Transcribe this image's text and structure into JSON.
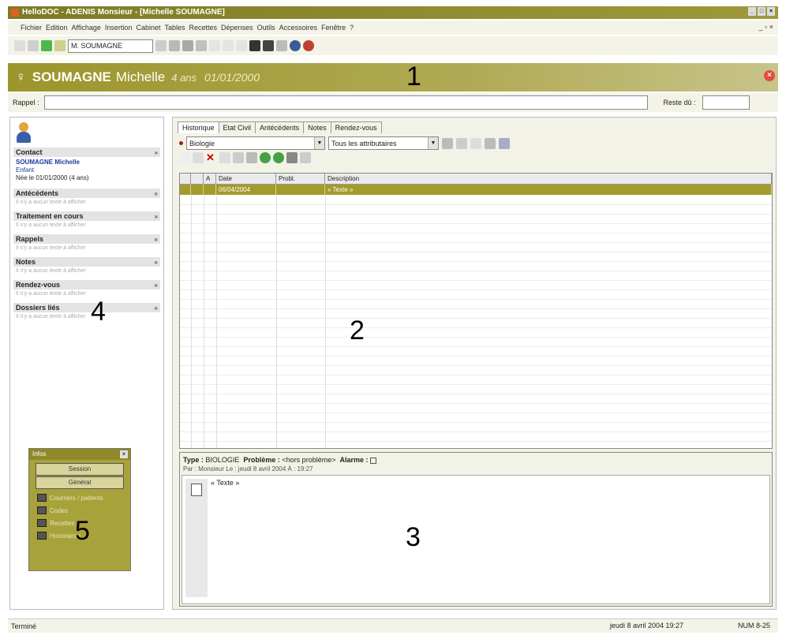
{
  "window": {
    "title": "HelloDOC - ADENIS Monsieur - [Michelle SOUMAGNE]"
  },
  "menu": [
    "Fichier",
    "Edition",
    "Affichage",
    "Insertion",
    "Cabinet",
    "Tables",
    "Recettes",
    "Dépenses",
    "Outils",
    "Accessoires",
    "Fenêtre",
    "?"
  ],
  "toolbar": {
    "patient_combo": "M. SOUMAGNE"
  },
  "header": {
    "last_name": "SOUMAGNE",
    "first_name": "Michelle",
    "age": "4 ans",
    "birth_date": "01/01/2000"
  },
  "rappel": {
    "label": "Rappel :",
    "value": "",
    "reste_label": "Reste dû :",
    "reste_value": ""
  },
  "left_panel": {
    "contact": {
      "title": "Contact",
      "name": "SOUMAGNE Michelle",
      "role": "Enfant",
      "born": "Née le 01/01/2000 (4 ans)"
    },
    "empty_text": "Il n'y a aucun texte à afficher",
    "sections": [
      "Antécédents",
      "Traitement en cours",
      "Rappels",
      "Notes",
      "Rendez-vous",
      "Dossiers liés"
    ]
  },
  "tabs": [
    "Historique",
    "Etat Civil",
    "Antécédents",
    "Notes",
    "Rendez-vous"
  ],
  "filters": {
    "type": "Biologie",
    "attributes": "Tous les attributaires"
  },
  "grid": {
    "columns": [
      "",
      "",
      "A",
      "Date",
      "Probl.",
      "Description"
    ],
    "rows": [
      {
        "c1": "",
        "c2": "",
        "date": "06/04/2004",
        "prob": "",
        "desc": "« Texte »"
      }
    ]
  },
  "detail": {
    "type_label": "Type :",
    "type_value": "BIOLOGIE",
    "problem_label": "Problème :",
    "problem_value": "<hors problème>",
    "alarm_label": "Alarme :",
    "sub": "Par : Monsieur  Le : jeudi 8 avril 2004  À : 19:27",
    "note_text": "« Texte »"
  },
  "widget": {
    "title": "Infos",
    "buttons": [
      "Session",
      "Général"
    ],
    "items": [
      "Courriers / patients",
      "Codes",
      "Recettes",
      "Honoraires"
    ]
  },
  "status": {
    "left": "Terminé",
    "date": "jeudi 8 avril 2004 19:27",
    "num": "NUM  8-25"
  },
  "callouts": [
    "1",
    "2",
    "3",
    "4",
    "5"
  ]
}
